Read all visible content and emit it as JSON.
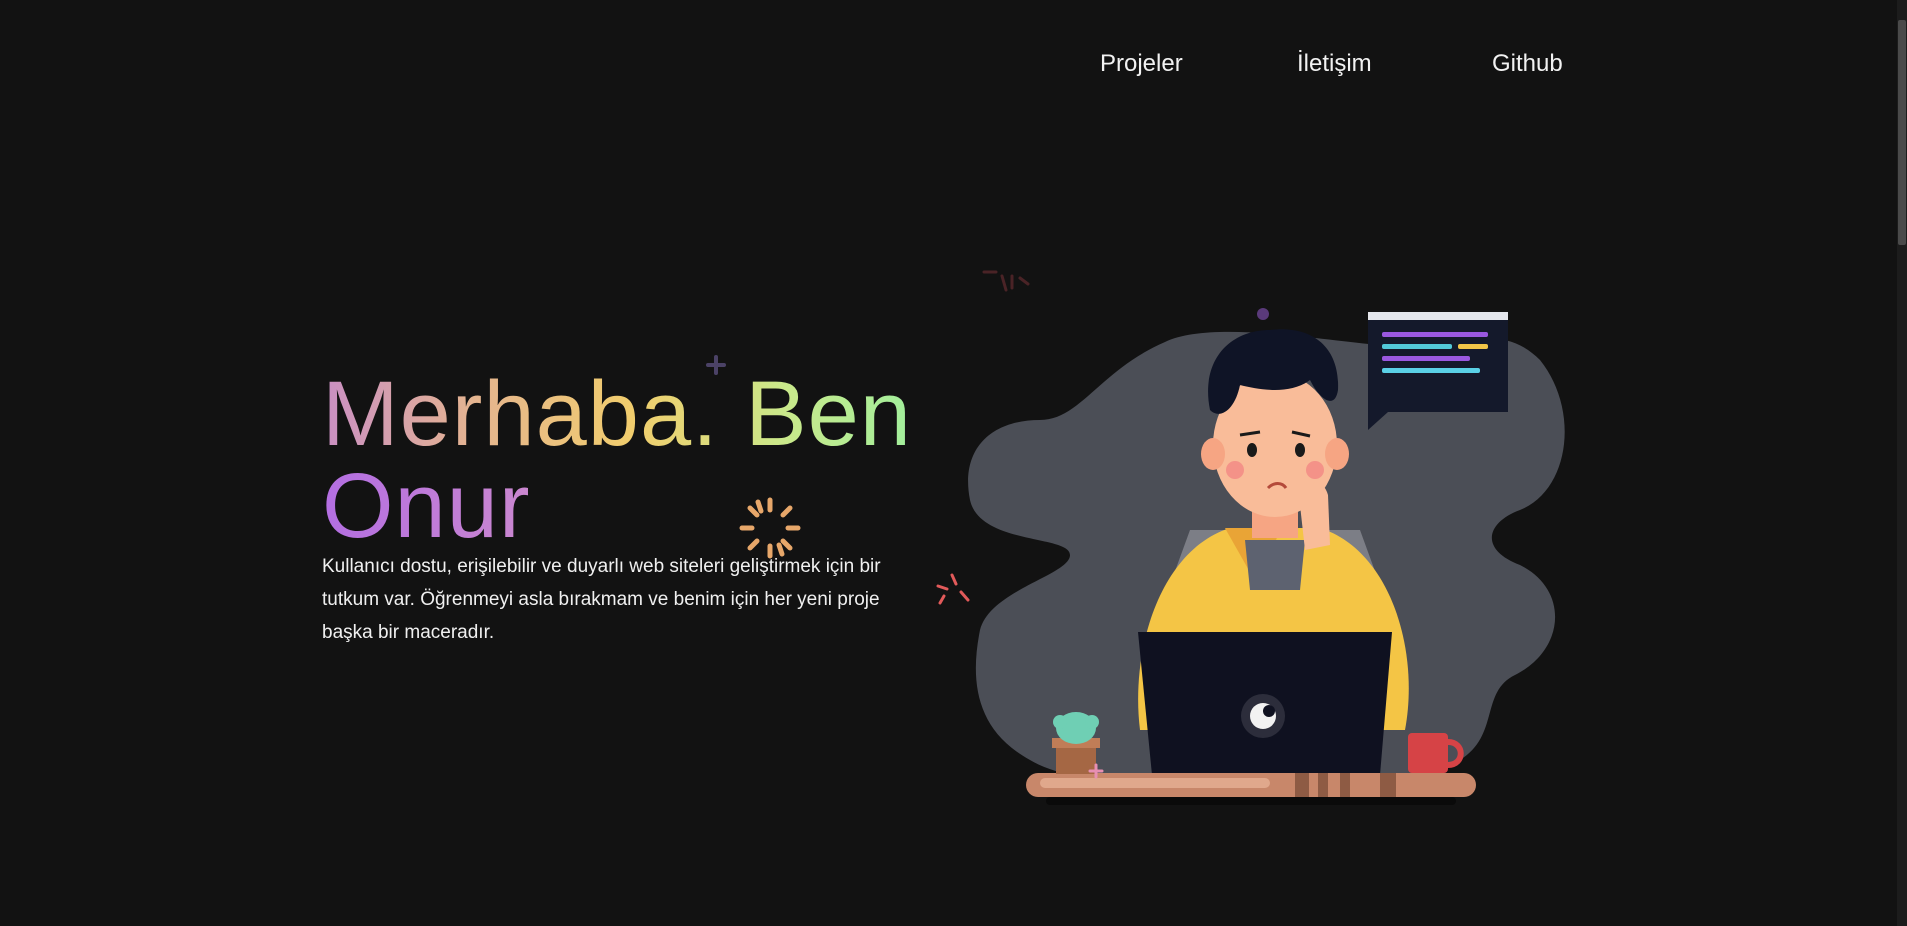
{
  "nav": {
    "items": [
      {
        "label": "Projeler"
      },
      {
        "label": "İletişim"
      },
      {
        "label": "Github"
      }
    ]
  },
  "hero": {
    "title_line1": "Merhaba. Ben",
    "title_line2": "Onur",
    "description": "Kullanıcı dostu, erişilebilir ve duyarlı web siteleri geliştirmek için bir tutkum var. Öğrenmeyi asla bırakmam ve benim için her yeni proje başka bir maceradır."
  },
  "colors": {
    "background": "#121212",
    "blob": "#4b4e56",
    "hoodie": "#f4c545",
    "laptop": "#0f1120",
    "desk": "#c8876a"
  },
  "icons": {
    "decorations": [
      "sparkle-icon",
      "plus-icon",
      "dot-icon",
      "burst-icon"
    ]
  }
}
